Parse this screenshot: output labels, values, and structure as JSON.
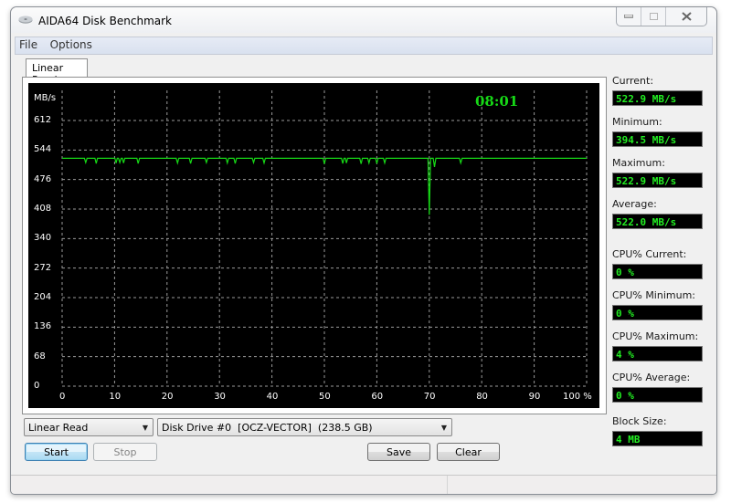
{
  "window": {
    "title": "AIDA64 Disk Benchmark",
    "controls": [
      "minimize",
      "maximize",
      "close"
    ]
  },
  "menu": [
    "File",
    "Options"
  ],
  "tabs": [
    {
      "label": "Linear Read",
      "active": true
    }
  ],
  "chart_data": {
    "type": "line",
    "title": "",
    "timer": "08:01",
    "ylabel": "MB/s",
    "xlabel": "%",
    "yticks": [
      "0",
      "68",
      "136",
      "204",
      "272",
      "340",
      "408",
      "476",
      "544",
      "612"
    ],
    "xticks": [
      "0",
      "10",
      "20",
      "30",
      "40",
      "50",
      "60",
      "70",
      "80",
      "90",
      "100 %"
    ],
    "ylim": [
      0,
      680
    ],
    "xlim": [
      0,
      100
    ],
    "grid": true,
    "line_color": "#16d816",
    "series": [
      {
        "name": "Linear Read",
        "baseline": 525,
        "dips": [
          {
            "x": 4.5,
            "y": 515
          },
          {
            "x": 6.5,
            "y": 513
          },
          {
            "x": 10.3,
            "y": 514
          },
          {
            "x": 11,
            "y": 515
          },
          {
            "x": 11.7,
            "y": 514
          },
          {
            "x": 14.5,
            "y": 513
          },
          {
            "x": 22,
            "y": 514
          },
          {
            "x": 24.5,
            "y": 513
          },
          {
            "x": 27.5,
            "y": 515
          },
          {
            "x": 31.5,
            "y": 514
          },
          {
            "x": 33,
            "y": 513
          },
          {
            "x": 36.5,
            "y": 515
          },
          {
            "x": 38.5,
            "y": 514
          },
          {
            "x": 50,
            "y": 512
          },
          {
            "x": 53.5,
            "y": 513
          },
          {
            "x": 54.2,
            "y": 514
          },
          {
            "x": 57,
            "y": 512
          },
          {
            "x": 58.5,
            "y": 514
          },
          {
            "x": 60,
            "y": 513
          },
          {
            "x": 61.5,
            "y": 514
          },
          {
            "x": 70,
            "y": 394.5
          },
          {
            "x": 71,
            "y": 505
          },
          {
            "x": 76,
            "y": 514
          }
        ]
      }
    ]
  },
  "stats": [
    {
      "label": "Current:",
      "value": "522.9 MB/s"
    },
    {
      "label": "Minimum:",
      "value": "394.5 MB/s"
    },
    {
      "label": "Maximum:",
      "value": "522.9 MB/s"
    },
    {
      "label": "Average:",
      "value": "522.0 MB/s"
    },
    {
      "label": "CPU% Current:",
      "value": "0 %"
    },
    {
      "label": "CPU% Minimum:",
      "value": "0 %"
    },
    {
      "label": "CPU% Maximum:",
      "value": "4 %"
    },
    {
      "label": "CPU% Average:",
      "value": "0 %"
    },
    {
      "label": "Block Size:",
      "value": "4 MB"
    }
  ],
  "controls": {
    "test_select": "Linear Read",
    "drive_select": "Disk Drive #0  [OCZ-VECTOR]  (238.5 GB)",
    "start": "Start",
    "stop": "Stop",
    "save": "Save",
    "clear": "Clear"
  }
}
